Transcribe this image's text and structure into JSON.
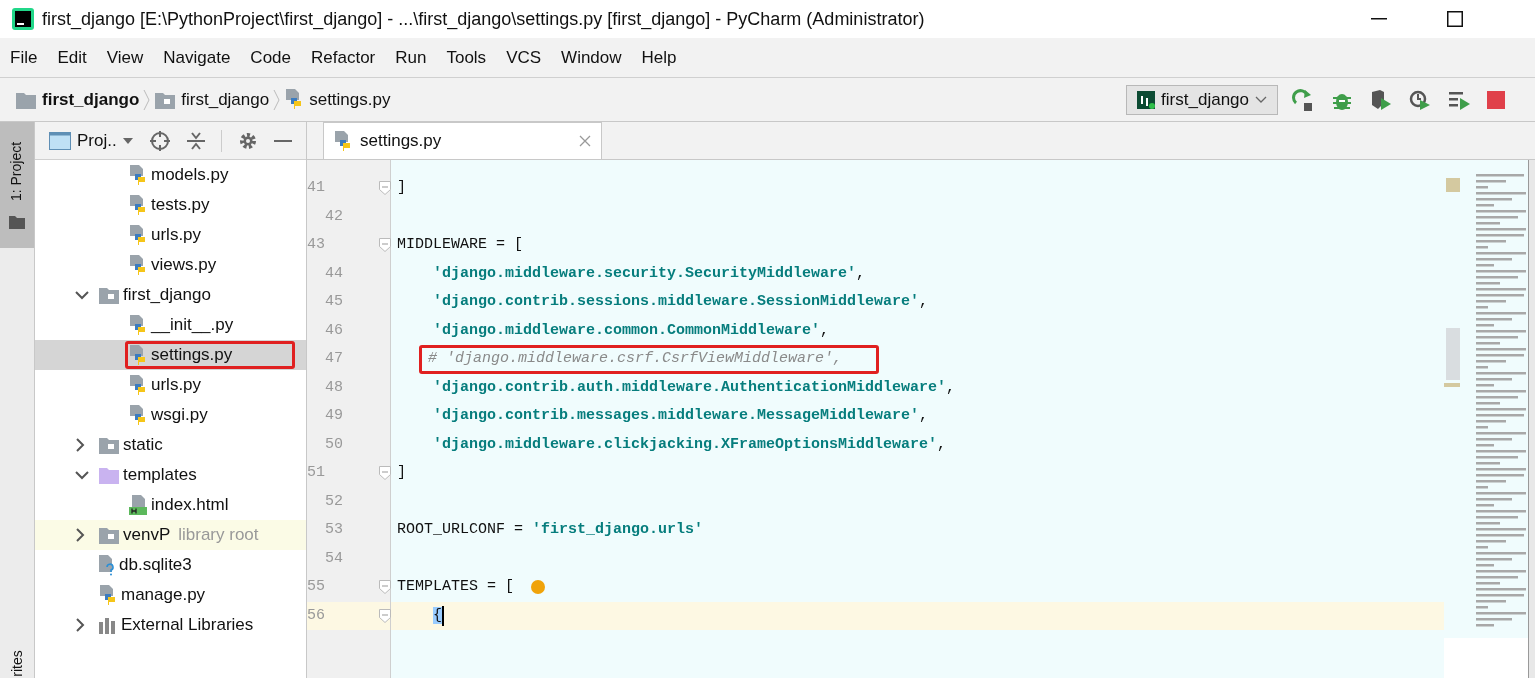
{
  "window": {
    "title": "first_django [E:\\PythonProject\\first_django] - ...\\first_django\\settings.py [first_django] - PyCharm (Administrator)"
  },
  "menu": [
    {
      "label": "File"
    },
    {
      "label": "Edit"
    },
    {
      "label": "View"
    },
    {
      "label": "Navigate"
    },
    {
      "label": "Code"
    },
    {
      "label": "Refactor"
    },
    {
      "label": "Run"
    },
    {
      "label": "Tools"
    },
    {
      "label": "VCS"
    },
    {
      "label": "Window"
    },
    {
      "label": "Help"
    }
  ],
  "breadcrumbs": [
    {
      "label": "first_django",
      "kind": "project"
    },
    {
      "label": "first_django",
      "kind": "folder"
    },
    {
      "label": "settings.py",
      "kind": "py"
    }
  ],
  "run_config": {
    "label": "first_django"
  },
  "tool_strip": {
    "top": "1: Project",
    "bottom": "rites"
  },
  "project_panel": {
    "view_label": "Proj..",
    "tree": [
      {
        "kind": "hidden",
        "children": [
          {
            "label": "models.py",
            "kind": "py",
            "selected": false,
            "annotated": false
          },
          {
            "label": "tests.py",
            "kind": "py",
            "selected": false,
            "annotated": false
          },
          {
            "label": "urls.py",
            "kind": "py",
            "selected": false,
            "annotated": false
          },
          {
            "label": "views.py",
            "kind": "py",
            "selected": false,
            "annotated": false
          }
        ]
      },
      {
        "label": "first_django",
        "kind": "folder",
        "expanded": true,
        "selected": false,
        "annotated": false,
        "children": [
          {
            "label": "__init__.py",
            "kind": "py",
            "selected": false,
            "annotated": false
          },
          {
            "label": "settings.py",
            "kind": "py",
            "selected": true,
            "annotated": true
          },
          {
            "label": "urls.py",
            "kind": "py",
            "selected": false,
            "annotated": false
          },
          {
            "label": "wsgi.py",
            "kind": "py",
            "selected": false,
            "annotated": false
          }
        ]
      },
      {
        "label": "static",
        "kind": "folder",
        "expanded": false,
        "selected": false,
        "annotated": false
      },
      {
        "label": "templates",
        "kind": "template-folder",
        "expanded": true,
        "selected": false,
        "annotated": false,
        "children": [
          {
            "label": "index.html",
            "kind": "html",
            "selected": false,
            "annotated": false
          }
        ]
      },
      {
        "label": "venvP",
        "hint": "library root",
        "kind": "library",
        "expanded": false,
        "selected": false,
        "annotated": false
      },
      {
        "label": "db.sqlite3",
        "kind": "unknown",
        "selected": false,
        "annotated": false
      },
      {
        "label": "manage.py",
        "kind": "py",
        "selected": false,
        "annotated": false
      },
      {
        "label": "External Libraries",
        "kind": "libraries",
        "expanded": false,
        "selected": false,
        "annotated": false
      }
    ]
  },
  "editor": {
    "tabs": [
      {
        "label": "settings.py",
        "selected": true
      }
    ],
    "lines": [
      {
        "number": "41",
        "fold": true,
        "current": false,
        "annotated": false,
        "indented": false,
        "segments": [
          {
            "kind": "plain",
            "text": "]"
          }
        ]
      },
      {
        "number": "42",
        "fold": false,
        "current": false
      },
      {
        "number": "43",
        "fold": true,
        "current": false,
        "annotated": false,
        "indented": false,
        "segments": [
          {
            "kind": "plain",
            "text": "MIDDLEWARE = ["
          }
        ]
      },
      {
        "number": "44",
        "fold": false,
        "current": false,
        "annotated": false,
        "indented": true,
        "segments": [
          {
            "kind": "string",
            "text": "'django.middleware.security.SecurityMiddleware'"
          },
          {
            "kind": "plain",
            "text": ","
          }
        ]
      },
      {
        "number": "45",
        "fold": false,
        "current": false,
        "annotated": false,
        "indented": true,
        "segments": [
          {
            "kind": "string",
            "text": "'django.contrib.sessions.middleware.SessionMiddleware'"
          },
          {
            "kind": "plain",
            "text": ","
          }
        ]
      },
      {
        "number": "46",
        "fold": false,
        "current": false,
        "annotated": false,
        "indented": true,
        "segments": [
          {
            "kind": "string",
            "text": "'django.middleware.common.CommonMiddleware'"
          },
          {
            "kind": "plain",
            "text": ","
          }
        ]
      },
      {
        "number": "47",
        "fold": false,
        "current": false,
        "annotated": true,
        "indented": true,
        "segments": [
          {
            "kind": "comment",
            "text": "# 'django.middleware.csrf.CsrfViewMiddleware',"
          }
        ]
      },
      {
        "number": "48",
        "fold": false,
        "current": false,
        "annotated": false,
        "indented": true,
        "segments": [
          {
            "kind": "string",
            "text": "'django.contrib.auth.middleware.AuthenticationMiddleware'"
          },
          {
            "kind": "plain",
            "text": ","
          }
        ]
      },
      {
        "number": "49",
        "fold": false,
        "current": false,
        "annotated": false,
        "indented": true,
        "segments": [
          {
            "kind": "string",
            "text": "'django.contrib.messages.middleware.MessageMiddleware'"
          },
          {
            "kind": "plain",
            "text": ","
          }
        ]
      },
      {
        "number": "50",
        "fold": false,
        "current": false,
        "annotated": false,
        "indented": true,
        "segments": [
          {
            "kind": "string",
            "text": "'django.middleware.clickjacking.XFrameOptionsMiddleware'"
          },
          {
            "kind": "plain",
            "text": ","
          }
        ]
      },
      {
        "number": "51",
        "fold": true,
        "current": false,
        "annotated": false,
        "indented": false,
        "segments": [
          {
            "kind": "plain",
            "text": "]"
          }
        ]
      },
      {
        "number": "52",
        "fold": false,
        "current": false
      },
      {
        "number": "53",
        "fold": false,
        "current": false,
        "annotated": false,
        "indented": false,
        "segments": [
          {
            "kind": "plain",
            "text": "ROOT_URLCONF = "
          },
          {
            "kind": "string",
            "text": "'first_django.urls'"
          }
        ]
      },
      {
        "number": "54",
        "fold": false,
        "current": false
      },
      {
        "number": "55",
        "fold": true,
        "current": false,
        "annotated": false,
        "indented": false,
        "bulb": true,
        "segments": [
          {
            "kind": "plain",
            "text": "TEMPLATES = ["
          }
        ]
      },
      {
        "number": "56",
        "fold": true,
        "current": true,
        "annotated": false,
        "indented": true,
        "segments": [
          {
            "kind": "brace",
            "text": "{"
          }
        ]
      }
    ]
  }
}
